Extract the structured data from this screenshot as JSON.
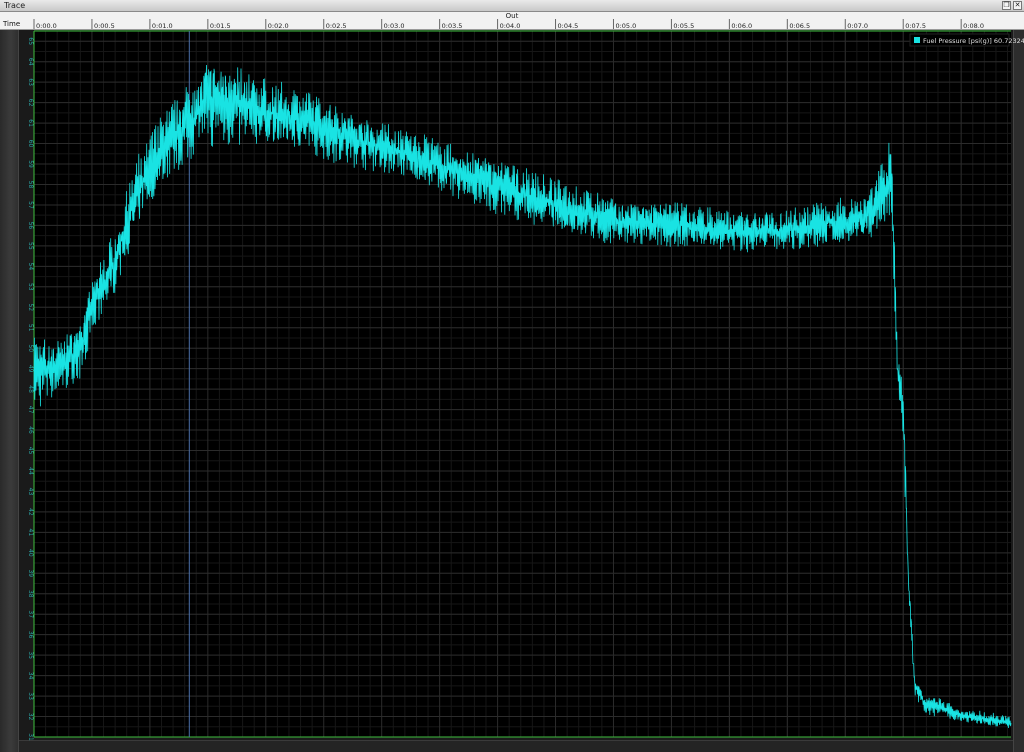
{
  "window": {
    "title": "Trace",
    "restore_icon": "restore-icon",
    "close_icon": "close-icon",
    "close_glyph": "✕",
    "restore_glyph": "❐"
  },
  "timeline": {
    "label": "Time",
    "header": "Out"
  },
  "colors": {
    "background": "#000000",
    "grid_major": "#2b2b2b",
    "grid_minor": "#161616",
    "trace": "#19e3e3",
    "axis_green": "#3fbf3f",
    "cursor": "#4a6fa8",
    "tick_text": "#2aa6a6"
  },
  "chart_data": {
    "type": "line",
    "x_ticks": [
      "0:00.0",
      "0:00.5",
      "0:01.0",
      "0:01.5",
      "0:02.0",
      "0:02.5",
      "0:03.0",
      "0:03.5",
      "0:04.0",
      "0:04.5",
      "0:05.0",
      "0:05.5",
      "0:06.0",
      "0:06.5",
      "0:07.0",
      "0:07.5",
      "0:08.0"
    ],
    "xlim": [
      0.0,
      8.43
    ],
    "ylim": [
      31,
      65.5
    ],
    "y_ticks": [
      31,
      32,
      33,
      34,
      35,
      36,
      37,
      38,
      39,
      40,
      41,
      42,
      43,
      44,
      45,
      46,
      47,
      48,
      49,
      50,
      51,
      52,
      53,
      54,
      55,
      56,
      57,
      58,
      59,
      60,
      61,
      62,
      63,
      64,
      65
    ],
    "cursor_x": 1.34,
    "grid": true,
    "legend_position": "top-right",
    "series": [
      {
        "name": "Fuel Pressure [psi(g)]",
        "legend_value": "60.723240",
        "envelope": {
          "x": [
            0.0,
            0.2,
            0.4,
            0.5,
            0.7,
            0.9,
            1.1,
            1.3,
            1.5,
            1.7,
            2.0,
            2.3,
            2.6,
            3.0,
            3.5,
            4.0,
            4.5,
            5.0,
            5.5,
            6.0,
            6.5,
            7.0,
            7.2,
            7.35,
            7.4,
            7.45,
            7.5,
            7.55,
            7.6,
            7.7,
            7.8,
            8.0,
            8.43
          ],
          "low": [
            46.8,
            47.4,
            48.5,
            50.5,
            52.5,
            55.5,
            57.8,
            58.8,
            59.8,
            59.8,
            59.6,
            59.5,
            59.0,
            58.5,
            57.5,
            56.5,
            55.5,
            55.0,
            54.8,
            54.6,
            54.7,
            54.8,
            55.0,
            56.0,
            56.0,
            48.0,
            45.0,
            37.0,
            33.0,
            32.0,
            32.0,
            31.7,
            31.3
          ],
          "high": [
            50.8,
            50.8,
            51.5,
            53.5,
            56.0,
            59.5,
            61.5,
            63.0,
            64.6,
            64.4,
            63.2,
            62.8,
            62.2,
            61.2,
            60.2,
            59.5,
            58.3,
            57.5,
            57.2,
            56.8,
            57.0,
            57.4,
            58.0,
            59.8,
            60.8,
            50.0,
            48.5,
            39.0,
            34.0,
            33.0,
            33.0,
            32.4,
            32.1
          ]
        }
      }
    ]
  }
}
